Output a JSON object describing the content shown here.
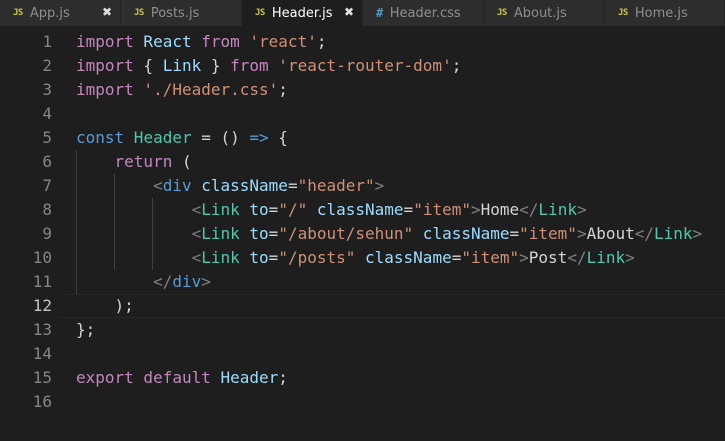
{
  "tabs": [
    {
      "icon": "JS",
      "label": "App.js",
      "close": "✖",
      "active": false
    },
    {
      "icon": "JS",
      "label": "Posts.js",
      "close": "",
      "active": false
    },
    {
      "icon": "JS",
      "label": "Header.js",
      "close": "✖",
      "active": true
    },
    {
      "icon": "#",
      "label": "Header.css",
      "close": "",
      "active": false
    },
    {
      "icon": "JS",
      "label": "About.js",
      "close": "",
      "active": false
    },
    {
      "icon": "JS",
      "label": "Home.js",
      "close": "",
      "active": false
    }
  ],
  "line_numbers": [
    "1",
    "2",
    "3",
    "4",
    "5",
    "6",
    "7",
    "8",
    "9",
    "10",
    "11",
    "12",
    "13",
    "14",
    "15",
    "16"
  ],
  "current_line": 12,
  "code": {
    "l1": {
      "kw1": "import",
      "id1": " React ",
      "kw2": "from",
      "st1": " 'react'",
      "p1": ";"
    },
    "l2": {
      "kw1": "import",
      "p1": " { ",
      "id1": "Link",
      "p2": " } ",
      "kw2": "from",
      "st1": " 'react-router-dom'",
      "p3": ";"
    },
    "l3": {
      "kw1": "import",
      "st1": " './Header.css'",
      "p1": ";"
    },
    "l5": {
      "kw1": "const",
      "cn1": " Header",
      "p1": " = () ",
      "dc1": "=>",
      "p2": " {"
    },
    "l6": {
      "ind": "    ",
      "kw1": "return",
      "p1": " ("
    },
    "l7": {
      "ind": "        ",
      "br1": "<",
      "tg1": "div",
      "at1": " className",
      "p1": "=",
      "st1": "\"header\"",
      "br2": ">"
    },
    "l8": {
      "ind": "            ",
      "br1": "<",
      "tg1": "Link",
      "at1": " to",
      "p1": "=",
      "st1": "\"/\"",
      "at2": " className",
      "p2": "=",
      "st2": "\"item\"",
      "br2": ">",
      "tx": "Home",
      "br3": "</",
      "tg2": "Link",
      "br4": ">"
    },
    "l9": {
      "ind": "            ",
      "br1": "<",
      "tg1": "Link",
      "at1": " to",
      "p1": "=",
      "st1": "\"/about/sehun\"",
      "at2": " className",
      "p2": "=",
      "st2": "\"item\"",
      "br2": ">",
      "tx": "About",
      "br3": "</",
      "tg2": "Link",
      "br4": ">"
    },
    "l10": {
      "ind": "            ",
      "br1": "<",
      "tg1": "Link",
      "at1": " to",
      "p1": "=",
      "st1": "\"/posts\"",
      "at2": " className",
      "p2": "=",
      "st2": "\"item\"",
      "br2": ">",
      "tx": "Post",
      "br3": "</",
      "tg2": "Link",
      "br4": ">"
    },
    "l11": {
      "ind": "        ",
      "br1": "</",
      "tg1": "div",
      "br2": ">"
    },
    "l12": {
      "ind": "    ",
      "p1": ");"
    },
    "l13": {
      "p1": "};"
    },
    "l15": {
      "kw1": "export",
      "dc1": " default",
      "id1": " Header",
      "p1": ";"
    }
  }
}
